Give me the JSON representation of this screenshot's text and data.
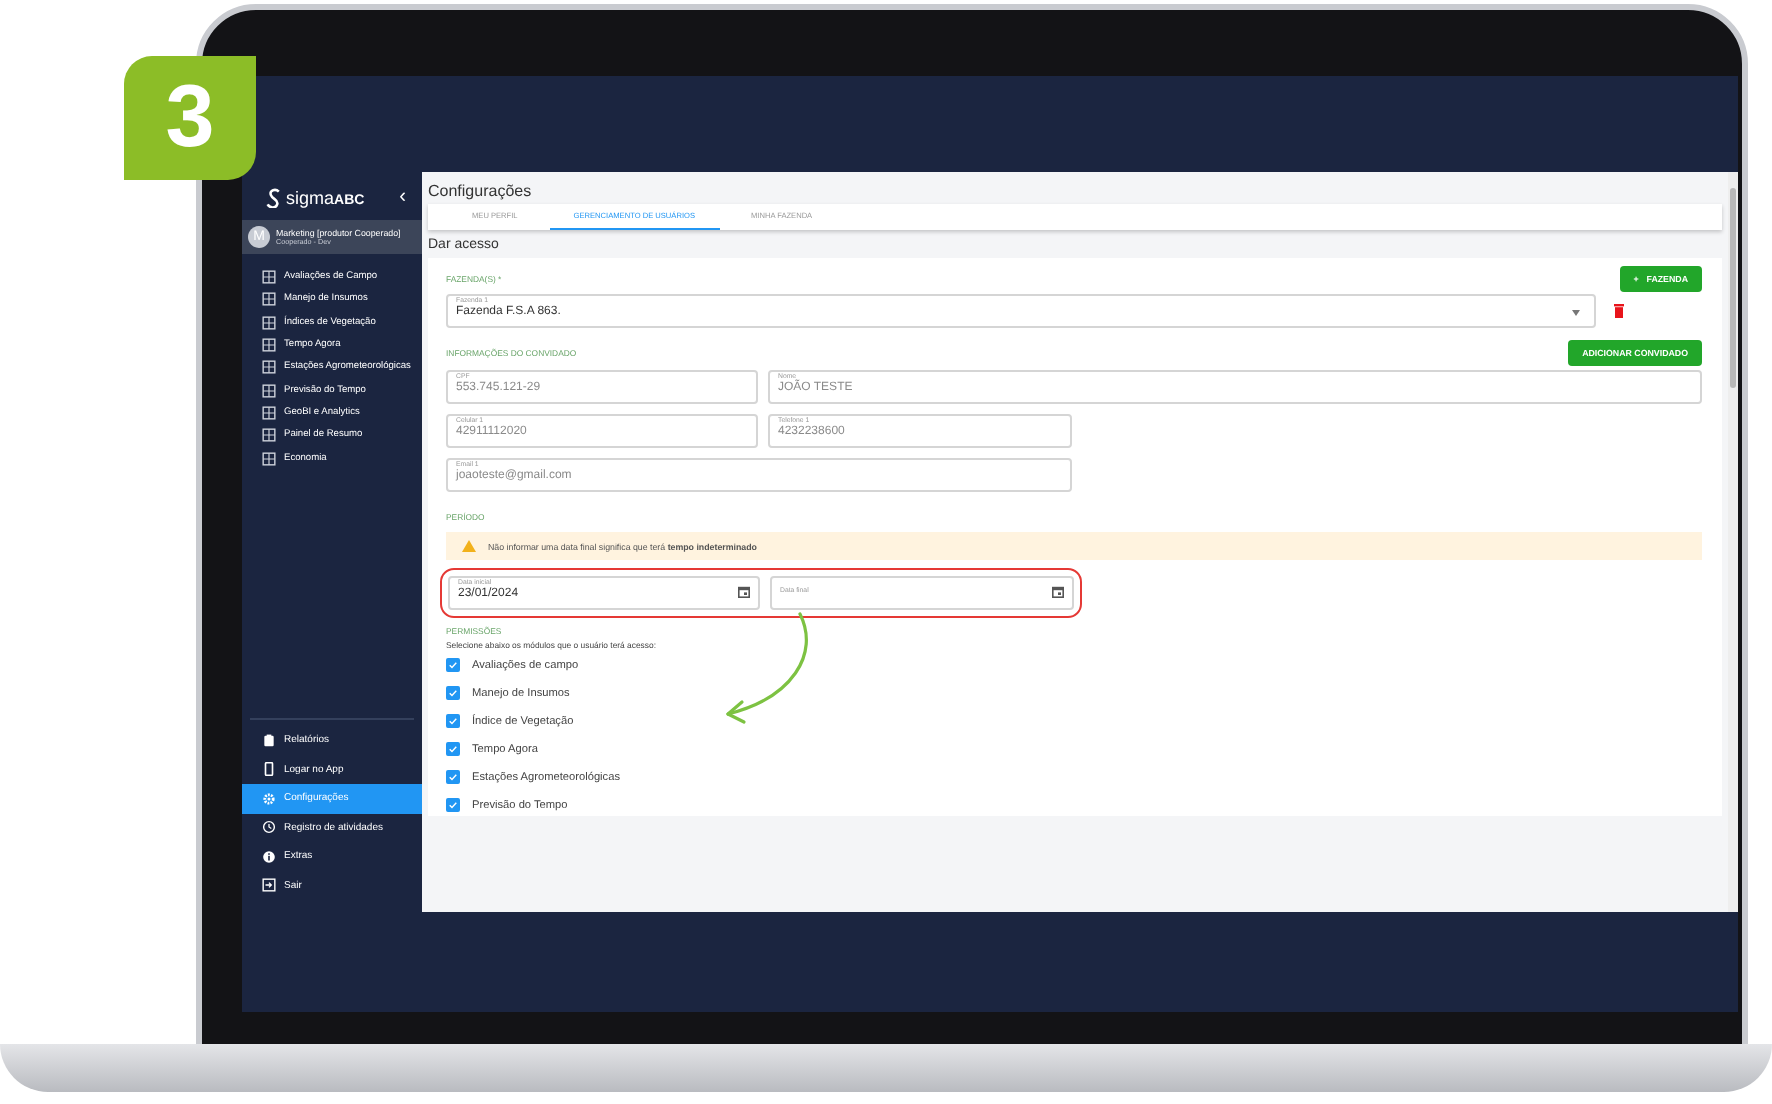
{
  "step_badge": "3",
  "sidebar": {
    "logo": {
      "prefix": "sigma",
      "suffix": "ABC"
    },
    "collapse": "‹",
    "user": {
      "initial": "M",
      "name": "Marketing [produtor Cooperado]",
      "role": "Cooperado - Dev"
    },
    "items": [
      {
        "label": "Avaliações de Campo",
        "selected": false
      },
      {
        "label": "Manejo de Insumos",
        "selected": false
      },
      {
        "label": "Índices de Vegetação",
        "selected": false
      },
      {
        "label": "Tempo Agora",
        "selected": false
      },
      {
        "label": "Estações Agrometeorológicas",
        "selected": false
      },
      {
        "label": "Previsão do Tempo",
        "selected": false
      },
      {
        "label": "GeoBI e Analytics",
        "selected": false
      },
      {
        "label": "Painel de Resumo",
        "selected": false
      },
      {
        "label": "Economia",
        "selected": false
      }
    ],
    "bottom_items": [
      {
        "label": "Relatórios",
        "selected": false
      },
      {
        "label": "Logar no App",
        "selected": false
      },
      {
        "label": "Configurações",
        "selected": true
      },
      {
        "label": "Registro de atividades",
        "selected": false
      },
      {
        "label": "Extras",
        "selected": false
      },
      {
        "label": "Sair",
        "selected": false
      }
    ]
  },
  "page": {
    "title": "Configurações",
    "tabs": [
      {
        "label": "MEU PERFIL",
        "selected": false
      },
      {
        "label": "GERENCIAMENTO DE USUÁRIOS",
        "selected": true
      },
      {
        "label": "MINHA FAZENDA",
        "selected": false
      }
    ],
    "section_title": "Dar acesso",
    "farms": {
      "heading": "FAZENDA(S) *",
      "add_button": {
        "icon": "+",
        "label": "FAZENDA"
      },
      "select": {
        "label": "Fazenda 1",
        "value": "Fazenda F.S.A 863."
      }
    },
    "guest": {
      "heading": "INFORMAÇÕES DO CONVIDADO",
      "add_button": "ADICIONAR CONVIDADO",
      "fields": [
        {
          "label": "CPF",
          "value": "553.745.121-29",
          "disabled": true
        },
        {
          "label": "Nome",
          "value": "JOÃO TESTE",
          "disabled": true
        },
        {
          "label": "Celular 1",
          "value": "42911112020",
          "disabled": true
        },
        {
          "label": "Telefone 1",
          "value": "4232238600",
          "disabled": true
        },
        {
          "label": "Email 1",
          "value": "joaoteste@gmail.com",
          "disabled": true
        }
      ]
    },
    "period": {
      "heading": "PERÍODO",
      "alert": "Não informar uma data final significa que terá **tempo indeterminado**",
      "start": {
        "label": "Data inicial",
        "value": "23/01/2024"
      },
      "end": {
        "label": "Data final"
      }
    },
    "permissions": {
      "heading": "PERMISSÕES",
      "hint": "Selecione abaixo os módulos que o usuário terá acesso:",
      "modules": [
        {
          "label": "Avaliações de campo",
          "checked": true
        },
        {
          "label": "Manejo de Insumos",
          "checked": true
        },
        {
          "label": "Índice de Vegetação",
          "checked": true
        },
        {
          "label": "Tempo Agora",
          "checked": true
        },
        {
          "label": "Estações Agrometeorológicas",
          "checked": true
        },
        {
          "label": "Previsão do Tempo",
          "checked": true
        }
      ]
    }
  }
}
